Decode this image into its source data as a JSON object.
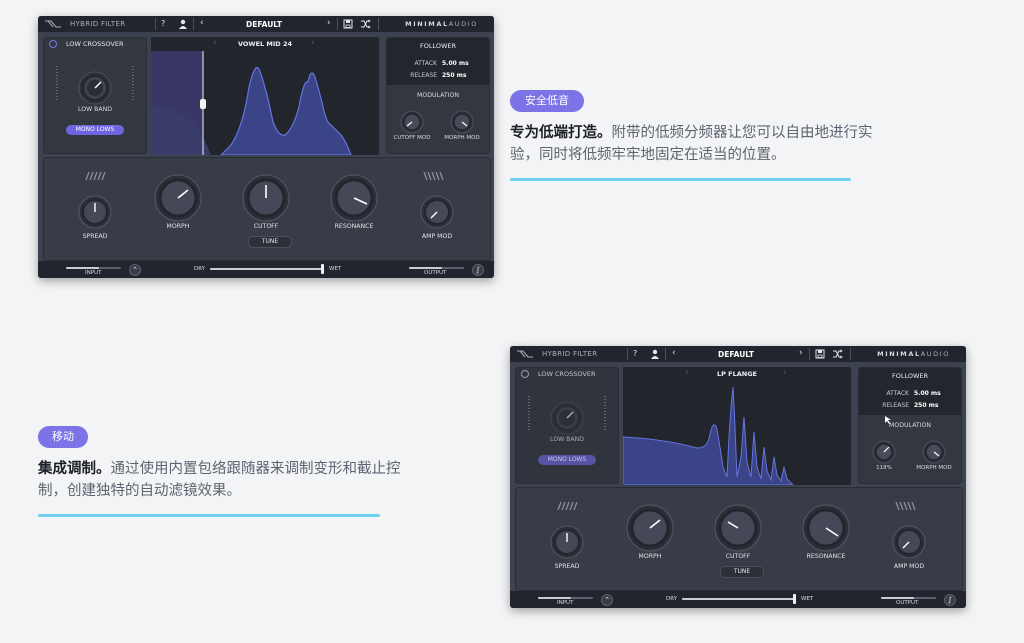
{
  "plugins": [
    {
      "app_name": "HYBRID FILTER",
      "preset": "DEFAULT",
      "brand_bold": "MINIMAL",
      "brand_light": "AUDIO",
      "crossover": {
        "title": "LOW CROSSOVER",
        "enabled": true,
        "band_label": "LOW BAND",
        "mono_label": "MONO LOWS"
      },
      "display": {
        "filter_type": "VOWEL MID 24"
      },
      "follower": {
        "title": "FOLLOWER",
        "attack_label": "ATTACK",
        "attack_value": "5.00 ms",
        "release_label": "RELEASE",
        "release_value": "250 ms"
      },
      "modulation": {
        "title": "MODULATION",
        "mod1_label": "CUTOFF MOD",
        "mod2_label": "MORPH MOD"
      },
      "knobs": {
        "spread": "SPREAD",
        "morph": "MORPH",
        "cutoff": "CUTOFF",
        "resonance": "RESONANCE",
        "amp_mod": "AMP MOD"
      },
      "tune_label": "TUNE",
      "bottom": {
        "input": "INPUT",
        "dry": "DRY",
        "wet": "WET",
        "output": "OUTPUT",
        "mix_fraction": 0.98,
        "input_fraction": 0.6,
        "output_fraction": 0.6
      }
    },
    {
      "app_name": "HYBRID FILTER",
      "preset": "DEFAULT",
      "brand_bold": "MINIMAL",
      "brand_light": "AUDIO",
      "crossover": {
        "title": "LOW CROSSOVER",
        "enabled": false,
        "band_label": "LOW BAND",
        "mono_label": "MONO LOWS"
      },
      "display": {
        "filter_type": "LP FLANGE"
      },
      "follower": {
        "title": "FOLLOWER",
        "attack_label": "ATTACK",
        "attack_value": "5.00 ms",
        "release_label": "RELEASE",
        "release_value": "250 ms"
      },
      "modulation": {
        "title": "MODULATION",
        "mod1_label": "118%",
        "mod2_label": "MORPH MOD"
      },
      "knobs": {
        "spread": "SPREAD",
        "morph": "MORPH",
        "cutoff": "CUTOFF",
        "resonance": "RESONANCE",
        "amp_mod": "AMP MOD"
      },
      "tune_label": "TUNE",
      "bottom": {
        "input": "INPUT",
        "dry": "DRY",
        "wet": "WET",
        "output": "OUTPUT",
        "mix_fraction": 0.98,
        "input_fraction": 0.6,
        "output_fraction": 0.6
      }
    }
  ],
  "features": [
    {
      "badge": "安全低音",
      "bold": "专为低端打造。",
      "line1_rest": "附带的低频分频器让您可以自由地进行实",
      "line2": "验，同时将低频牢牢地固定在适当的位置。"
    },
    {
      "badge": "移动",
      "bold": "集成调制。",
      "line1_rest": "通过使用内置包络跟随器来调制变形和截止控",
      "line2": "制，创建独特的自动滤镜效果。"
    }
  ],
  "colors": {
    "accent": "#7c73e6",
    "underline": "#6fd0f0",
    "panel": "#3d4250",
    "curve": "#5a67d8"
  }
}
